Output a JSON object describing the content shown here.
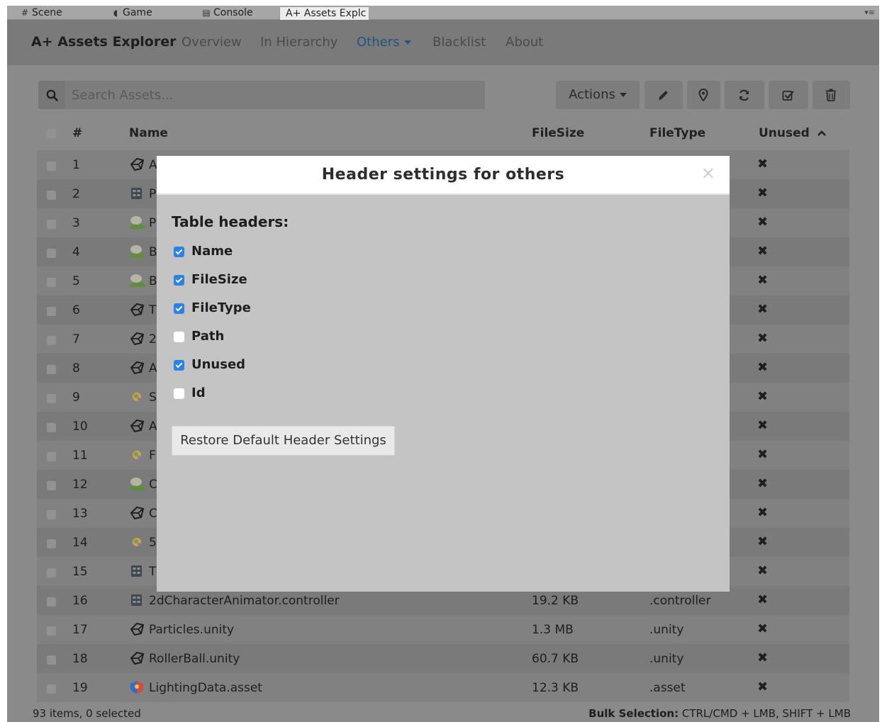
{
  "tabs": [
    {
      "label": "Scene",
      "icon": "hash-icon"
    },
    {
      "label": "Game",
      "icon": "pacman-icon"
    },
    {
      "label": "Console",
      "icon": "console-icon"
    },
    {
      "label": "A+ Assets Explc",
      "icon": ""
    }
  ],
  "navbar": {
    "brand": "A+ Assets Explorer",
    "items": [
      "Overview",
      "In Hierarchy",
      "Others",
      "Blacklist",
      "About"
    ],
    "active": "Others"
  },
  "toolbar": {
    "search_placeholder": "Search Assets...",
    "actions_label": "Actions",
    "icon_buttons": [
      "pencil-icon",
      "map-marker-icon",
      "refresh-icon",
      "check-square-icon",
      "trash-icon"
    ]
  },
  "table": {
    "headers": {
      "num": "#",
      "name": "Name",
      "filesize": "FileSize",
      "filetype": "FileType",
      "unused": "Unused"
    },
    "rows": [
      {
        "num": "1",
        "icon": "unity-icon",
        "name": "A",
        "size": "",
        "type": "",
        "unused": "✖"
      },
      {
        "num": "2",
        "icon": "controller-icon",
        "name": "P",
        "size": "",
        "type": "",
        "unused": "✖"
      },
      {
        "num": "3",
        "icon": "terrain-icon",
        "name": "P",
        "size": "",
        "type": "",
        "unused": "✖"
      },
      {
        "num": "4",
        "icon": "terrain-icon",
        "name": "B",
        "size": "",
        "type": "",
        "unused": "✖"
      },
      {
        "num": "5",
        "icon": "terrain-icon",
        "name": "B",
        "size": "",
        "type": "",
        "unused": "✖"
      },
      {
        "num": "6",
        "icon": "unity-icon",
        "name": "T",
        "size": "",
        "type": "",
        "unused": "✖"
      },
      {
        "num": "7",
        "icon": "unity-icon",
        "name": "2",
        "size": "",
        "type": "",
        "unused": "✖"
      },
      {
        "num": "8",
        "icon": "unity-icon",
        "name": "A",
        "size": "",
        "type": "",
        "unused": "✖"
      },
      {
        "num": "9",
        "icon": "sun-icon",
        "name": "S",
        "size": "",
        "type": "",
        "unused": "✖"
      },
      {
        "num": "10",
        "icon": "unity-icon",
        "name": "A",
        "size": "",
        "type": "",
        "unused": "✖"
      },
      {
        "num": "11",
        "icon": "sun-icon",
        "name": "F",
        "size": "",
        "type": "",
        "unused": "✖"
      },
      {
        "num": "12",
        "icon": "terrain-icon",
        "name": "C",
        "size": "",
        "type": "",
        "unused": "✖"
      },
      {
        "num": "13",
        "icon": "unity-icon",
        "name": "C",
        "size": "",
        "type": "",
        "unused": "✖"
      },
      {
        "num": "14",
        "icon": "sun-icon",
        "name": "5",
        "size": "",
        "type": "",
        "unused": "✖"
      },
      {
        "num": "15",
        "icon": "controller-icon",
        "name": "T",
        "size": "",
        "type": "",
        "unused": "✖"
      },
      {
        "num": "16",
        "icon": "controller-icon",
        "name": "2dCharacterAnimator.controller",
        "size": "19.2 KB",
        "type": ".controller",
        "unused": "✖"
      },
      {
        "num": "17",
        "icon": "unity-icon",
        "name": "Particles.unity",
        "size": "1.3 MB",
        "type": ".unity",
        "unused": "✖"
      },
      {
        "num": "18",
        "icon": "unity-icon",
        "name": "RollerBall.unity",
        "size": "60.7 KB",
        "type": ".unity",
        "unused": "✖"
      },
      {
        "num": "19",
        "icon": "lighting-data-icon",
        "name": "LightingData.asset",
        "size": "12.3 KB",
        "type": ".asset",
        "unused": "✖"
      }
    ]
  },
  "footer": {
    "count": "93 items, 0 selected",
    "bulk_label": "Bulk Selection:",
    "bulk_text": "CTRL/CMD + LMB, SHIFT + LMB"
  },
  "modal": {
    "title": "Header settings for others",
    "close": "×",
    "section_title": "Table headers:",
    "options": [
      {
        "label": "Name",
        "checked": true
      },
      {
        "label": "FileSize",
        "checked": true
      },
      {
        "label": "FileType",
        "checked": true
      },
      {
        "label": "Path",
        "checked": false
      },
      {
        "label": "Unused",
        "checked": true
      },
      {
        "label": "Id",
        "checked": false
      }
    ],
    "restore_label": "Restore Default Header Settings"
  },
  "colors": {
    "accent": "#24547e",
    "checkbox_checked": "#2a82e6",
    "overlay": "#8a8a8a",
    "modal_body": "#c4c4c4"
  }
}
